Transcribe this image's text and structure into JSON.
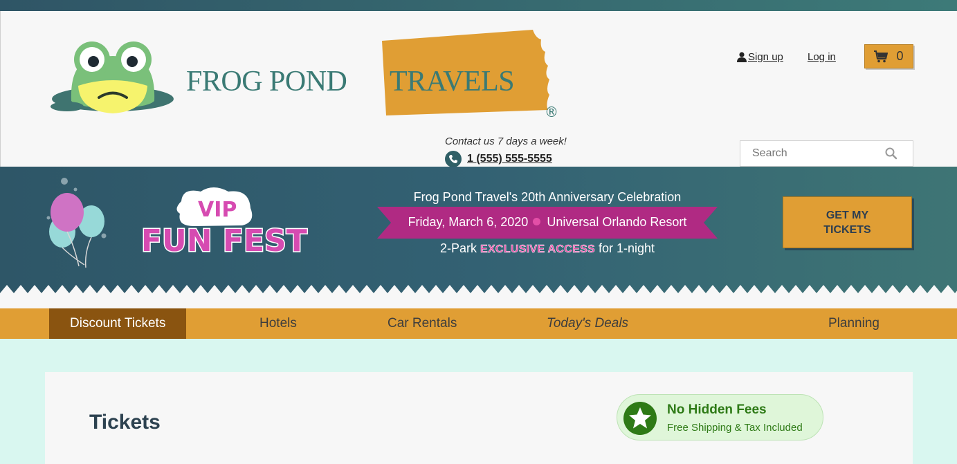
{
  "brand": {
    "name_part1": "FROG POND",
    "name_part2": "TRAVELS",
    "registered": "®",
    "colors": {
      "teal": "#3a7a74",
      "gold": "#e09e34",
      "navy": "#2e5667",
      "pink": "#e34fa7"
    }
  },
  "header": {
    "contact_text": "Contact us 7 days a week!",
    "phone": "1 (555) 555-5555",
    "signup_label": "Sign up",
    "login_label": "Log in",
    "cart_count": "0",
    "search_placeholder": "Search"
  },
  "banner": {
    "vip_label": "VIP",
    "funfest_label": "FUN FEST",
    "anniversary": "Frog Pond Travel's 20th Anniversary Celebration",
    "date": "Friday, March 6, 2020",
    "venue": "Universal Orlando Resort",
    "access_prefix": "2-Park",
    "access_highlight": "EXCLUSIVE ACCESS",
    "access_suffix": "for 1-night",
    "cta_line1": "GET MY",
    "cta_line2": "TICKETS"
  },
  "nav": {
    "items": [
      {
        "label": "Discount Tickets",
        "active": true
      },
      {
        "label": "Hotels"
      },
      {
        "label": "Car Rentals"
      },
      {
        "label": "Today's Deals"
      },
      {
        "label": "Planning"
      }
    ]
  },
  "main": {
    "title": "Tickets",
    "fees_title": "No Hidden Fees",
    "fees_sub": "Free Shipping & Tax Included"
  },
  "icons": [
    "frog-logo-icon",
    "user-icon",
    "cart-icon",
    "phone-icon",
    "search-icon",
    "balloons-icon",
    "star-icon"
  ]
}
